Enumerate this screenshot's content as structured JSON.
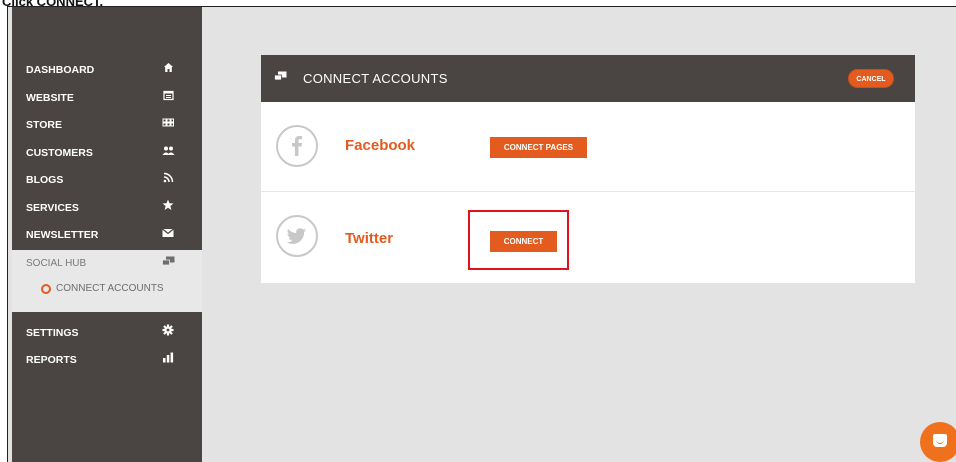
{
  "caption": "Click CONNECT.",
  "sidebar": {
    "items": [
      {
        "label": "DASHBOARD",
        "icon": "home-icon",
        "glyph": "⌂"
      },
      {
        "label": "WEBSITE",
        "icon": "website-icon",
        "glyph": "▤"
      },
      {
        "label": "STORE",
        "icon": "store-icon",
        "glyph": "▦"
      },
      {
        "label": "CUSTOMERS",
        "icon": "customers-icon",
        "glyph": "👥"
      },
      {
        "label": "BLOGS",
        "icon": "rss-icon",
        "glyph": "ᴧ"
      },
      {
        "label": "SERVICES",
        "icon": "star-icon",
        "glyph": "★"
      },
      {
        "label": "NEWSLETTER",
        "icon": "envelope-icon",
        "glyph": "✉"
      }
    ],
    "social_hub": {
      "label": "SOCIAL HUB",
      "icon": "chat-icon",
      "glyph": "▰"
    },
    "sub_item": {
      "label": "CONNECT ACCOUNTS"
    },
    "bottom_items": [
      {
        "label": "SETTINGS",
        "icon": "gear-icon",
        "glyph": "✱"
      },
      {
        "label": "REPORTS",
        "icon": "bar-chart-icon",
        "glyph": "▮"
      }
    ]
  },
  "card": {
    "title": "CONNECT ACCOUNTS",
    "cancel_label": "CANCEL",
    "rows": [
      {
        "name": "Facebook",
        "button": "CONNECT PAGES",
        "icon": "facebook-icon"
      },
      {
        "name": "Twitter",
        "button": "CONNECT",
        "icon": "twitter-icon"
      }
    ]
  },
  "colors": {
    "accent": "#e35b1e",
    "sidebar_bg": "#4a4542",
    "highlight": "#e0121b"
  }
}
